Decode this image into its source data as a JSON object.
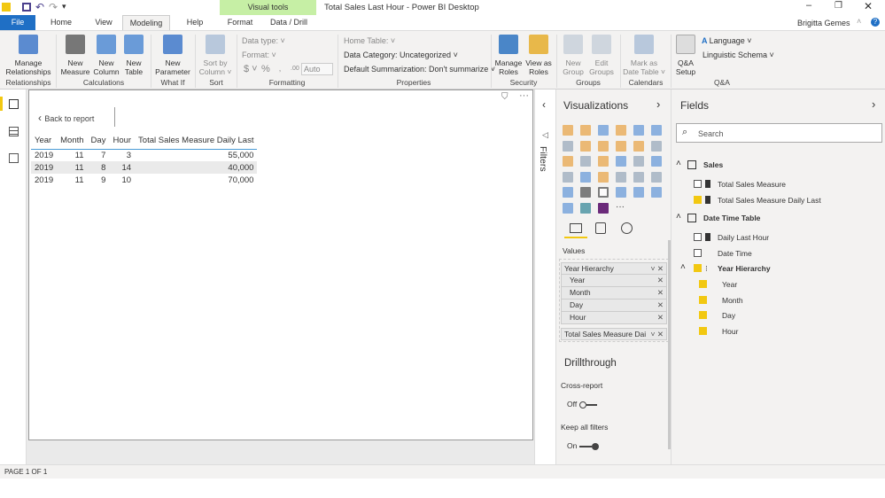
{
  "window": {
    "title": "Total Sales Last Hour - Power BI Desktop",
    "user": "Brigitta Gemes",
    "context_tab_group": "Visual tools"
  },
  "tabs": [
    "File",
    "Home",
    "View",
    "Modeling",
    "Help",
    "Format",
    "Data / Drill"
  ],
  "ribbon": {
    "buttons": [
      {
        "label1": "Manage",
        "label2": "Relationships",
        "color": "#5b8bd0"
      },
      {
        "label1": "New",
        "label2": "Measure",
        "color": "#777"
      },
      {
        "label1": "New",
        "label2": "Column",
        "color": "#6a9bd8"
      },
      {
        "label1": "New",
        "label2": "Table",
        "color": "#6a9bd8"
      },
      {
        "label1": "New",
        "label2": "Parameter",
        "color": "#5b8bd0"
      },
      {
        "label1": "Sort by",
        "label2": "Column ˅",
        "color": "#b8c8dc"
      },
      {
        "label1": "Manage",
        "label2": "Roles",
        "color": "#4a86c8"
      },
      {
        "label1": "View as",
        "label2": "Roles",
        "color": "#e8b84a"
      },
      {
        "label1": "New",
        "label2": "Group",
        "color": "#cfd6de"
      },
      {
        "label1": "Edit",
        "label2": "Groups",
        "color": "#cfd6de"
      },
      {
        "label1": "Mark as",
        "label2": "Date Table ˅",
        "color": "#b8c8dc"
      },
      {
        "label1": "Q&A",
        "label2": "Setup",
        "color": "#ccc"
      }
    ],
    "groups": [
      "Relationships",
      "Calculations",
      "What If",
      "Sort",
      "Formatting",
      "Properties",
      "Security",
      "Groups",
      "Calendars",
      "Q&A"
    ],
    "formatting": {
      "data_type": "Data type: ˅",
      "format": "Format: ˅",
      "currency": "$ ˅",
      "percent": "%",
      "comma": "‚",
      "decimal": ".00",
      "auto": "Auto"
    },
    "properties": {
      "home_table": "Home Table: ˅",
      "data_category": "Data Category: Uncategorized ˅",
      "default_summarization": "Default Summarization: Don't summarize ˅"
    },
    "qa": {
      "language": "Language ˅",
      "linguistic_schema": "Linguistic Schema ˅"
    }
  },
  "report": {
    "back_label": "Back to report",
    "columns": [
      "Year",
      "Month",
      "Day",
      "Hour",
      "Total Sales Measure Daily Last"
    ],
    "rows": [
      [
        "2019",
        "11",
        "7",
        "3",
        "55,000"
      ],
      [
        "2019",
        "11",
        "8",
        "14",
        "40,000"
      ],
      [
        "2019",
        "11",
        "9",
        "10",
        "70,000"
      ]
    ]
  },
  "filters": {
    "label": "Filters"
  },
  "visualizations": {
    "title": "Visualizations",
    "values_label": "Values",
    "hierarchy": "Year Hierarchy",
    "hierarchy_items": [
      "Year",
      "Month",
      "Day",
      "Hour"
    ],
    "measure_field": "Total Sales Measure Dai",
    "drillthrough": "Drillthrough",
    "cross_report": "Cross-report",
    "cross_report_state": "Off",
    "keep_filters": "Keep all filters",
    "keep_filters_state": "On",
    "more": "···"
  },
  "fields": {
    "title": "Fields",
    "search_placeholder": "Search",
    "tables": [
      {
        "name": "Sales",
        "items": [
          {
            "label": "Total Sales Measure",
            "checked": false
          },
          {
            "label": "Total Sales Measure Daily Last",
            "checked": true
          }
        ]
      },
      {
        "name": "Date Time Table",
        "items": [
          {
            "label": "Daily Last Hour",
            "checked": false
          },
          {
            "label": "Date Time",
            "checked": false
          }
        ]
      }
    ],
    "hierarchy": {
      "name": "Year Hierarchy",
      "checked": true,
      "items": [
        "Year",
        "Month",
        "Day",
        "Hour"
      ]
    }
  },
  "status": {
    "page": "PAGE 1 OF 1"
  },
  "colors": {
    "file_tab": "#1f6fc5",
    "accent": "#f2c811",
    "visual_tools": "#c6efa5"
  }
}
